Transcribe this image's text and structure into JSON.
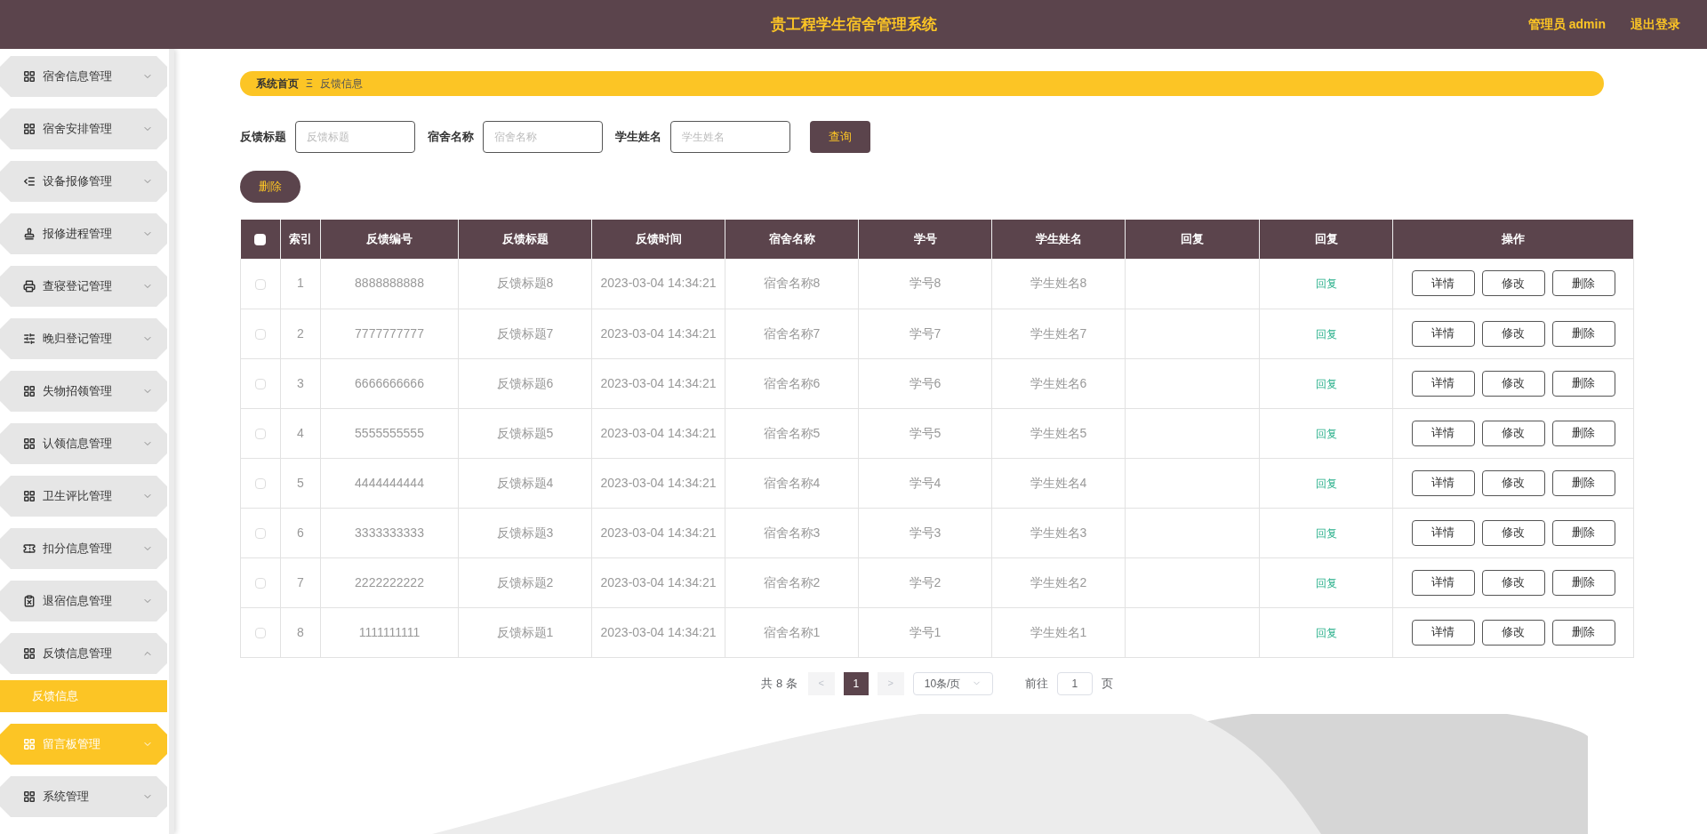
{
  "header": {
    "title": "贵工程学生宿舍管理系统",
    "user": "管理员 admin",
    "logout": "退出登录"
  },
  "sidebar": {
    "items": [
      {
        "label": "宿舍信息管理",
        "expanded": false,
        "active": false
      },
      {
        "label": "宿舍安排管理",
        "expanded": false,
        "active": false
      },
      {
        "label": "设备报修管理",
        "expanded": false,
        "active": false
      },
      {
        "label": "报修进程管理",
        "expanded": false,
        "active": false
      },
      {
        "label": "查寝登记管理",
        "expanded": false,
        "active": false
      },
      {
        "label": "晚归登记管理",
        "expanded": false,
        "active": false
      },
      {
        "label": "失物招领管理",
        "expanded": false,
        "active": false
      },
      {
        "label": "认领信息管理",
        "expanded": false,
        "active": false
      },
      {
        "label": "卫生评比管理",
        "expanded": false,
        "active": false
      },
      {
        "label": "扣分信息管理",
        "expanded": false,
        "active": false
      },
      {
        "label": "退宿信息管理",
        "expanded": false,
        "active": false
      },
      {
        "label": "反馈信息管理",
        "expanded": true,
        "active": false,
        "children": [
          {
            "label": "反馈信息",
            "selected": true
          }
        ]
      },
      {
        "label": "留言板管理",
        "expanded": false,
        "active": true
      },
      {
        "label": "系统管理",
        "expanded": false,
        "active": false
      }
    ]
  },
  "breadcrumb": [
    "系统首页",
    "Ξ",
    "反馈信息"
  ],
  "search": {
    "fields": [
      {
        "label": "反馈标题",
        "placeholder": "反馈标题"
      },
      {
        "label": "宿舍名称",
        "placeholder": "宿舍名称"
      },
      {
        "label": "学生姓名",
        "placeholder": "学生姓名"
      }
    ],
    "button": "查询"
  },
  "delete_button": "删除",
  "table": {
    "columns": [
      "索引",
      "反馈编号",
      "反馈标题",
      "反馈时间",
      "宿舍名称",
      "学号",
      "学生姓名",
      "回复",
      "回复",
      "操作"
    ],
    "header_checked": false,
    "rows": [
      {
        "checked": false,
        "cells": [
          "1",
          "8888888888",
          "反馈标题8",
          "2023-03-04 14:34:21",
          "宿舍名称8",
          "学号8",
          "学生姓名8"
        ],
        "reply_link": "回复",
        "actions": [
          "详情",
          "修改",
          "删除"
        ]
      },
      {
        "checked": false,
        "cells": [
          "2",
          "7777777777",
          "反馈标题7",
          "2023-03-04 14:34:21",
          "宿舍名称7",
          "学号7",
          "学生姓名7"
        ],
        "reply_link": "回复",
        "actions": [
          "详情",
          "修改",
          "删除"
        ]
      },
      {
        "checked": false,
        "cells": [
          "3",
          "6666666666",
          "反馈标题6",
          "2023-03-04 14:34:21",
          "宿舍名称6",
          "学号6",
          "学生姓名6"
        ],
        "reply_link": "回复",
        "actions": [
          "详情",
          "修改",
          "删除"
        ]
      },
      {
        "checked": false,
        "cells": [
          "4",
          "5555555555",
          "反馈标题5",
          "2023-03-04 14:34:21",
          "宿舍名称5",
          "学号5",
          "学生姓名5"
        ],
        "reply_link": "回复",
        "actions": [
          "详情",
          "修改",
          "删除"
        ]
      },
      {
        "checked": false,
        "cells": [
          "5",
          "4444444444",
          "反馈标题4",
          "2023-03-04 14:34:21",
          "宿舍名称4",
          "学号4",
          "学生姓名4"
        ],
        "reply_link": "回复",
        "actions": [
          "详情",
          "修改",
          "删除"
        ]
      },
      {
        "checked": false,
        "cells": [
          "6",
          "3333333333",
          "反馈标题3",
          "2023-03-04 14:34:21",
          "宿舍名称3",
          "学号3",
          "学生姓名3"
        ],
        "reply_link": "回复",
        "actions": [
          "详情",
          "修改",
          "删除"
        ]
      },
      {
        "checked": false,
        "cells": [
          "7",
          "2222222222",
          "反馈标题2",
          "2023-03-04 14:34:21",
          "宿舍名称2",
          "学号2",
          "学生姓名2"
        ],
        "reply_link": "回复",
        "actions": [
          "详情",
          "修改",
          "删除"
        ]
      },
      {
        "checked": false,
        "cells": [
          "8",
          "1111111111",
          "反馈标题1",
          "2023-03-04 14:34:21",
          "宿舍名称1",
          "学号1",
          "学生姓名1"
        ],
        "reply_link": "回复",
        "actions": [
          "详情",
          "修改",
          "删除"
        ]
      }
    ]
  },
  "pagination": {
    "total": "共 8 条",
    "prev": "<",
    "pages": [
      {
        "label": "1",
        "selected": true
      }
    ],
    "next": ">",
    "page_size": "10条/页",
    "goto_label": "前往",
    "goto_value": "1",
    "goto_suffix": "页"
  }
}
